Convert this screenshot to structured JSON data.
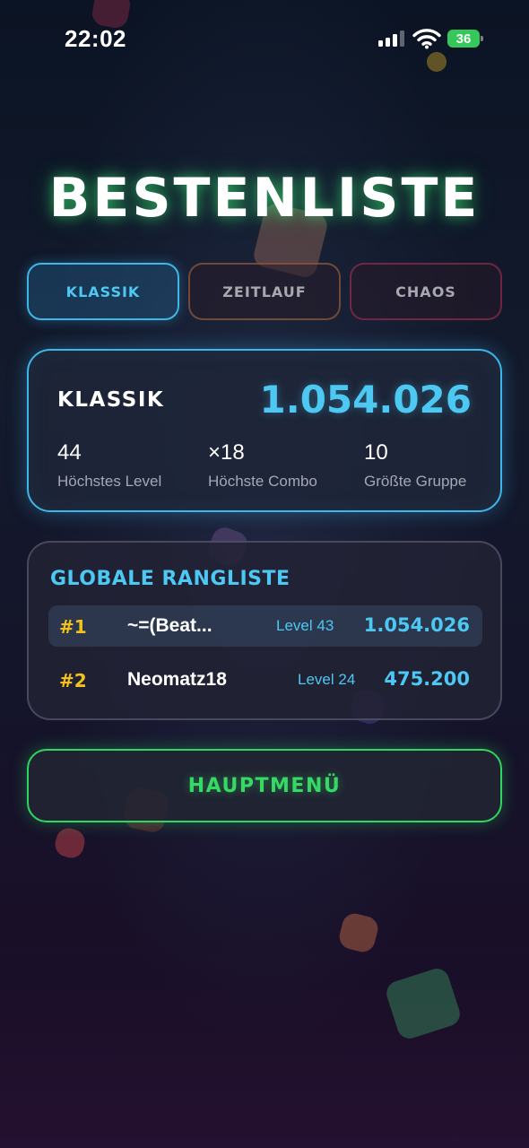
{
  "status_bar": {
    "time": "22:02",
    "battery": "36"
  },
  "title": "BESTENLISTE",
  "tabs": [
    {
      "label": "KLASSIK",
      "active": true
    },
    {
      "label": "ZEITLAUF",
      "active": false
    },
    {
      "label": "CHAOS",
      "active": false
    }
  ],
  "score_card": {
    "mode": "KLASSIK",
    "score": "1.054.026",
    "stats": [
      {
        "value": "44",
        "label": "Höchstes Level"
      },
      {
        "value": "×18",
        "label": "Höchste Combo"
      },
      {
        "value": "10",
        "label": "Größte Gruppe"
      }
    ]
  },
  "leaderboard": {
    "title": "GLOBALE RANGLISTE",
    "rows": [
      {
        "rank": "#1",
        "player": "~=(Beat...",
        "level": "Level 43",
        "score": "1.054.026"
      },
      {
        "rank": "#2",
        "player": "Neomatz18",
        "level": "Level 24",
        "score": "475.200"
      }
    ]
  },
  "main_menu_label": "HAUPTMENÜ",
  "colors": {
    "accent_blue": "#4cc8f2",
    "accent_green": "#35d963",
    "rank_gold": "#f2c21a"
  }
}
